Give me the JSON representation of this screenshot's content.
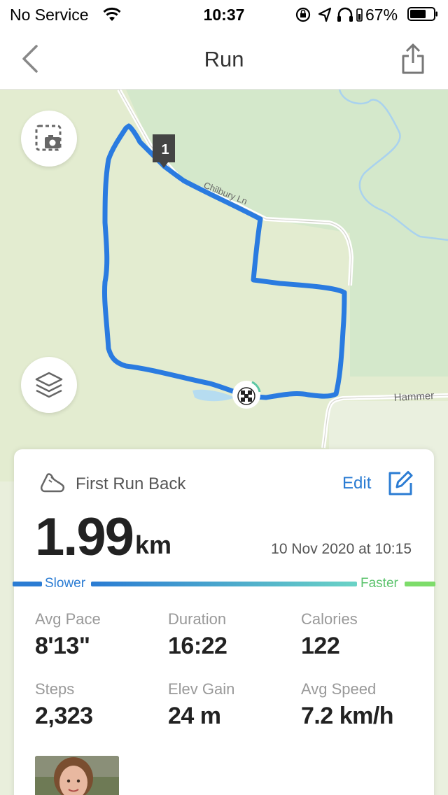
{
  "status_bar": {
    "carrier": "No Service",
    "time": "10:37",
    "battery_percent": "67%"
  },
  "nav": {
    "title": "Run"
  },
  "map": {
    "route_color": "#2a7be0",
    "lap_marker": "1",
    "road_labels": [
      "Chilbury Ln",
      "Hammer"
    ]
  },
  "card": {
    "run_name": "First Run  Back",
    "edit_label": "Edit",
    "distance": "1.99",
    "distance_unit": "km",
    "date": "10 Nov 2020 at 10:15",
    "legend": {
      "slower": "Slower",
      "faster": "Faster",
      "slower_color": "#2b7cd3",
      "faster_color": "#7ddc6a"
    },
    "stats": [
      {
        "label": "Avg Pace",
        "value": "8'13\""
      },
      {
        "label": "Duration",
        "value": "16:22"
      },
      {
        "label": "Calories",
        "value": "122"
      },
      {
        "label": "Steps",
        "value": "2,323"
      },
      {
        "label": "Elev Gain",
        "value": "24 m"
      },
      {
        "label": "Avg Speed",
        "value": "7.2 km/h"
      }
    ]
  }
}
